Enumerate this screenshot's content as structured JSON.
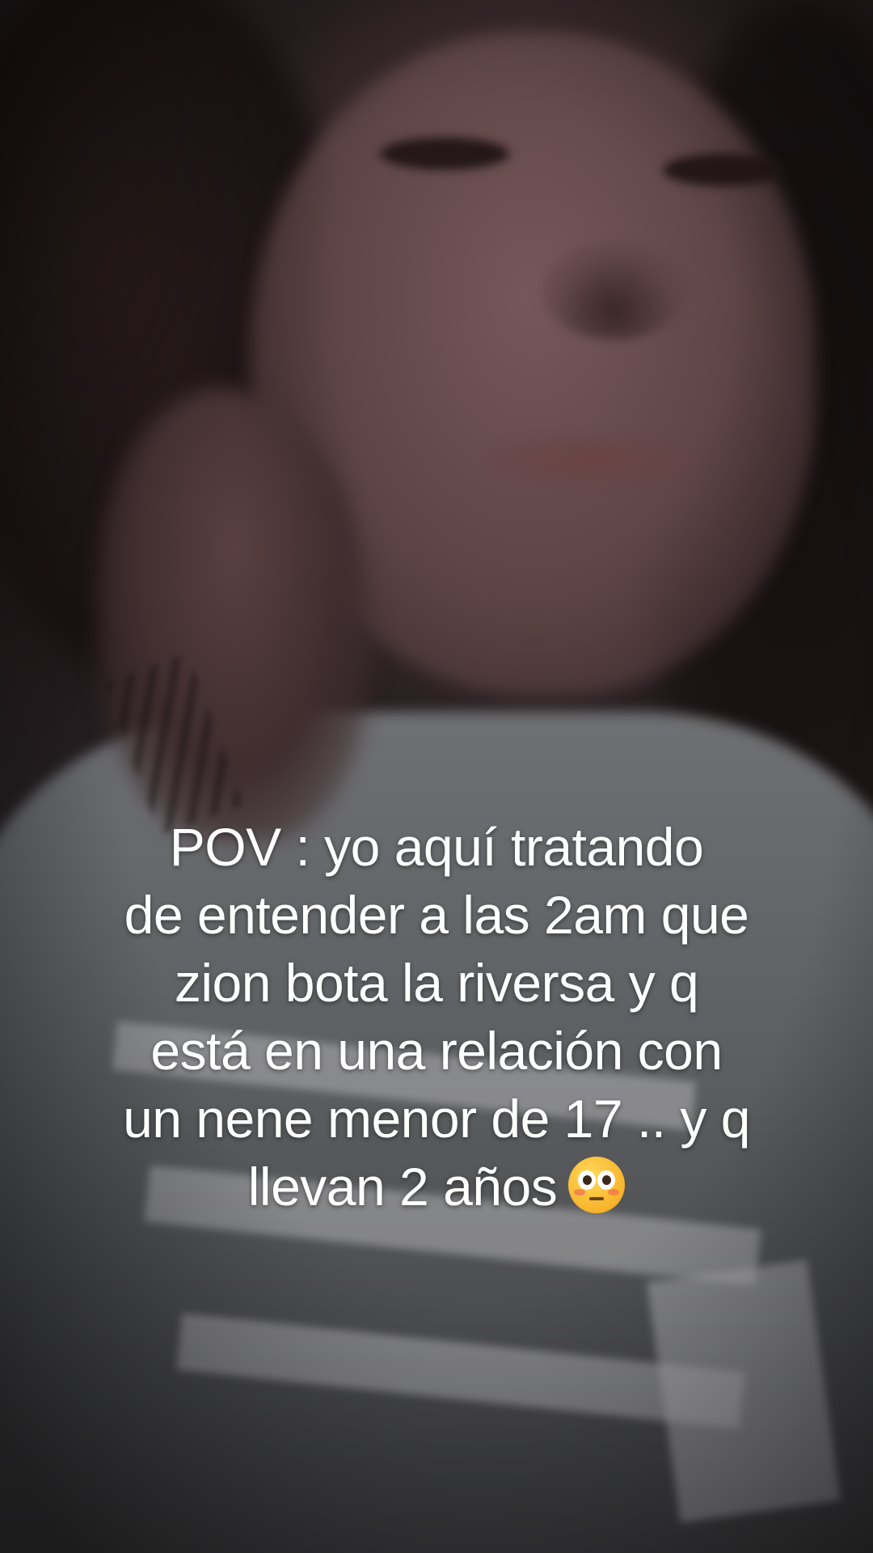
{
  "caption": {
    "lines": [
      "POV  :  yo aquí tratando",
      "de entender a las 2am que",
      "zion bota la riversa y q",
      "está en una relación con",
      "un nene menor de 17 .. y q",
      "llevan 2 años"
    ],
    "emoji": "flushed-face-icon"
  },
  "colors": {
    "caption_text": "#ffffff",
    "background": "#1a1516"
  }
}
